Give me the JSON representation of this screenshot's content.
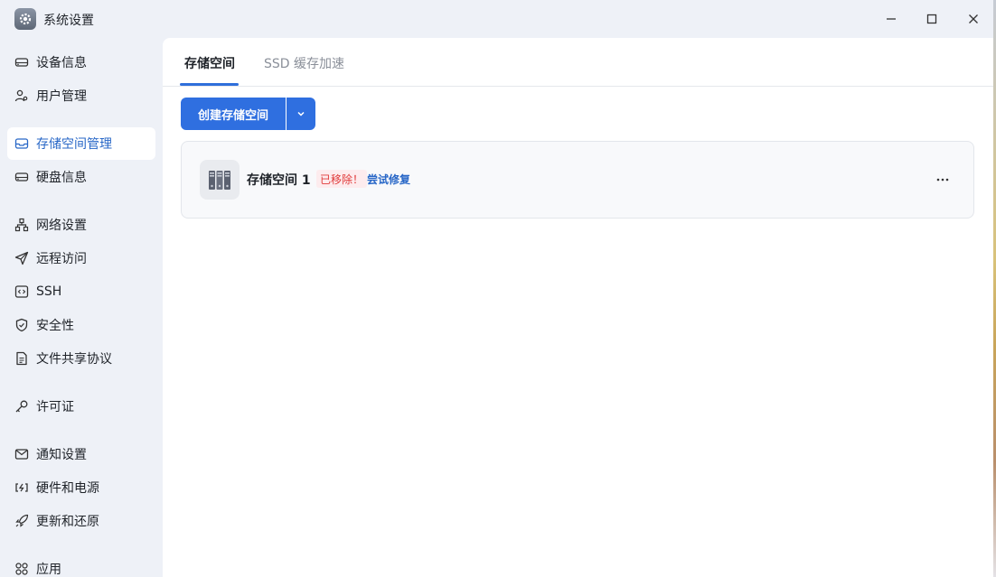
{
  "window": {
    "title": "系统设置"
  },
  "sidebar": {
    "items": [
      {
        "label": "设备信息",
        "icon": "drive-icon"
      },
      {
        "label": "用户管理",
        "icon": "users-icon"
      },
      {
        "label": "存储空间管理",
        "icon": "inbox-icon",
        "active": true
      },
      {
        "label": "硬盘信息",
        "icon": "harddisk-icon"
      },
      {
        "label": "网络设置",
        "icon": "network-icon"
      },
      {
        "label": "远程访问",
        "icon": "send-icon"
      },
      {
        "label": "SSH",
        "icon": "code-icon"
      },
      {
        "label": "安全性",
        "icon": "shield-icon"
      },
      {
        "label": "文件共享协议",
        "icon": "document-icon"
      },
      {
        "label": "许可证",
        "icon": "key-icon"
      },
      {
        "label": "通知设置",
        "icon": "mail-icon"
      },
      {
        "label": "硬件和电源",
        "icon": "power-icon"
      },
      {
        "label": "更新和还原",
        "icon": "rocket-icon"
      },
      {
        "label": "应用",
        "icon": "apps-icon"
      }
    ]
  },
  "tabs": [
    {
      "label": "存储空间",
      "active": true
    },
    {
      "label": "SSD 缓存加速",
      "active": false
    }
  ],
  "toolbar": {
    "create_label": "创建存储空间"
  },
  "storage_card": {
    "name": "存储空间 1",
    "status": "已移除！",
    "action": "尝试修复"
  },
  "colors": {
    "accent": "#2f6fe0",
    "active_text": "#2867c7",
    "error": "#e03a3a"
  }
}
